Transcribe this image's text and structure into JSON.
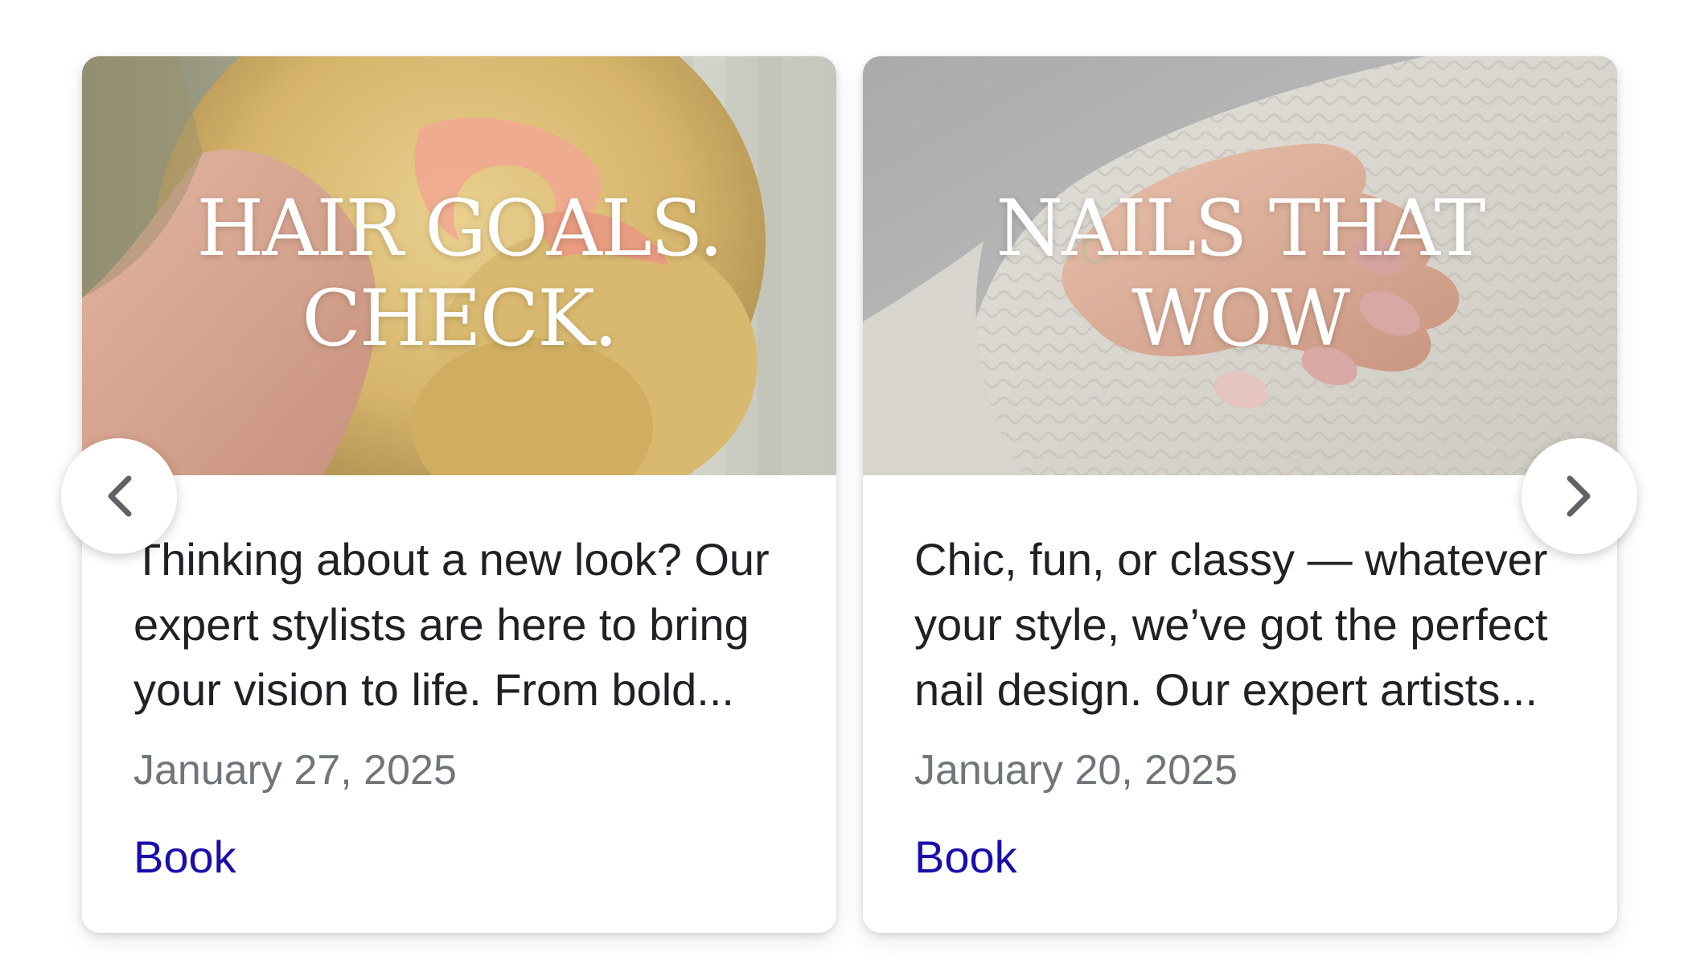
{
  "carousel": {
    "cards": [
      {
        "title_line1": "HAIR GOALS.",
        "title_line2": "CHECK.",
        "description": "Thinking about a new look? Our expert stylists are here to bring your vision to life. From bold...",
        "date": "January 27, 2025",
        "action_label": "Book",
        "image": "woman-with-curly-blonde-hair-and-pink-ribbon"
      },
      {
        "title_line1": "NAILS THAT",
        "title_line2": "WOW",
        "description": "Chic, fun, or classy — whatever your style, we’ve got the perfect nail design. Our expert artists...",
        "date": "January 20, 2025",
        "action_label": "Book",
        "image": "hand-with-pink-manicure-on-white-knit-sweater"
      }
    ],
    "prev_icon": "chevron-left-icon",
    "next_icon": "chevron-right-icon"
  },
  "colors": {
    "link": "#1a0dab",
    "text": "#202124",
    "muted": "#70757a"
  }
}
